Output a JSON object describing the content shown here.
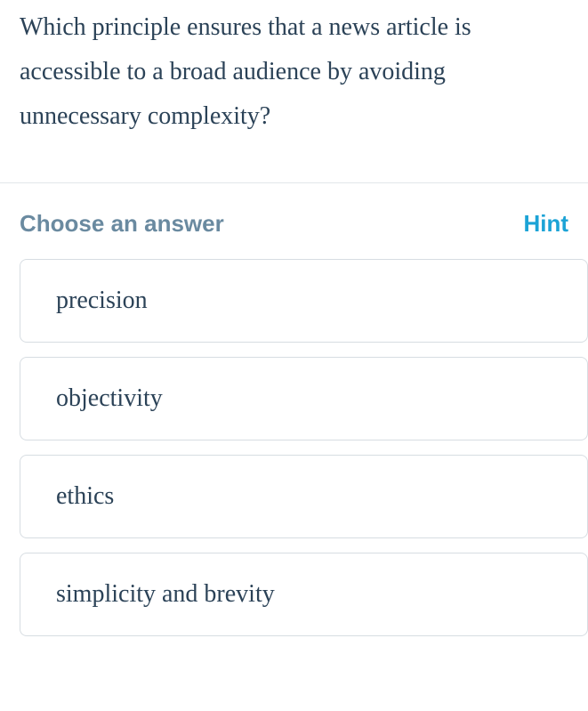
{
  "question": {
    "text": "Which principle ensures that a news article is accessible to a broad audience by avoiding unnecessary complexity?"
  },
  "chooseLabel": "Choose an answer",
  "hintLabel": "Hint",
  "answers": [
    {
      "label": "precision"
    },
    {
      "label": "objectivity"
    },
    {
      "label": "ethics"
    },
    {
      "label": "simplicity and brevity"
    }
  ]
}
